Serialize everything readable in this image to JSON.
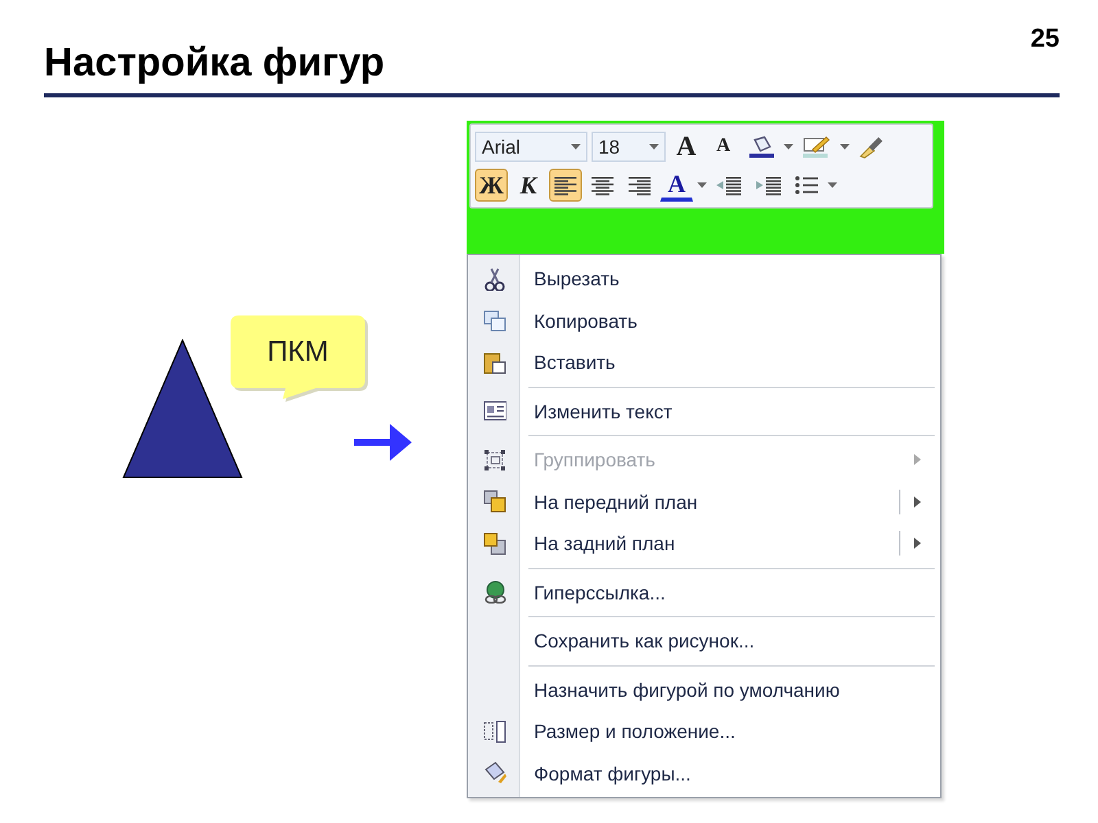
{
  "slide": {
    "title": "Настройка фигур",
    "page_number": "25"
  },
  "callout": {
    "text": "ПКМ"
  },
  "mini_toolbar": {
    "font_name": "Arial",
    "font_size": "18",
    "rows": [
      [
        {
          "kind": "letter",
          "label": "A",
          "pressed": false,
          "dropdown": false
        },
        {
          "kind": "letter",
          "label": "A",
          "pressed": false,
          "dropdown": false
        },
        {
          "kind": "icon",
          "pressed": false,
          "dropdown": true
        },
        {
          "kind": "icon",
          "pressed": false,
          "dropdown": true
        },
        {
          "kind": "icon",
          "pressed": false,
          "dropdown": false
        }
      ],
      [
        {
          "kind": "letter",
          "label": "Ж",
          "pressed": true,
          "dropdown": false
        },
        {
          "kind": "letter",
          "label": "К",
          "pressed": false,
          "dropdown": false
        },
        {
          "kind": "icon",
          "pressed": true,
          "dropdown": false
        },
        {
          "kind": "icon",
          "pressed": false,
          "dropdown": false
        },
        {
          "kind": "icon",
          "pressed": false,
          "dropdown": false
        },
        {
          "kind": "letter",
          "label": "A",
          "pressed": false,
          "dropdown": true
        },
        {
          "kind": "icon",
          "pressed": false,
          "dropdown": false
        },
        {
          "kind": "icon",
          "pressed": false,
          "dropdown": false
        },
        {
          "kind": "icon",
          "pressed": false,
          "dropdown": true
        }
      ]
    ]
  },
  "context_menu": {
    "entries": [
      {
        "kind": "item",
        "label": "Вырезать",
        "disabled": false,
        "submenu": false,
        "split": false
      },
      {
        "kind": "item",
        "label": "Копировать",
        "disabled": false,
        "submenu": false,
        "split": false
      },
      {
        "kind": "item",
        "label": "Вставить",
        "disabled": false,
        "submenu": false,
        "split": false
      },
      {
        "kind": "separator"
      },
      {
        "kind": "item",
        "label": "Изменить текст",
        "disabled": false,
        "submenu": false,
        "split": false
      },
      {
        "kind": "separator"
      },
      {
        "kind": "item",
        "label": "Группировать",
        "disabled": true,
        "submenu": true,
        "split": false
      },
      {
        "kind": "item",
        "label": "На передний план",
        "disabled": false,
        "submenu": true,
        "split": true
      },
      {
        "kind": "item",
        "label": "На задний план",
        "disabled": false,
        "submenu": true,
        "split": true
      },
      {
        "kind": "separator"
      },
      {
        "kind": "item",
        "label": "Гиперссылка...",
        "disabled": false,
        "submenu": false,
        "split": false
      },
      {
        "kind": "separator"
      },
      {
        "kind": "item",
        "label": "Сохранить как рисунок...",
        "disabled": false,
        "submenu": false,
        "split": false
      },
      {
        "kind": "separator"
      },
      {
        "kind": "item",
        "label": "Назначить фигурой по умолчанию",
        "disabled": false,
        "submenu": false,
        "split": false
      },
      {
        "kind": "item",
        "label": "Размер и положение...",
        "disabled": false,
        "submenu": false,
        "split": false
      },
      {
        "kind": "item",
        "label": "Формат фигуры...",
        "disabled": false,
        "submenu": false,
        "split": false
      }
    ]
  }
}
